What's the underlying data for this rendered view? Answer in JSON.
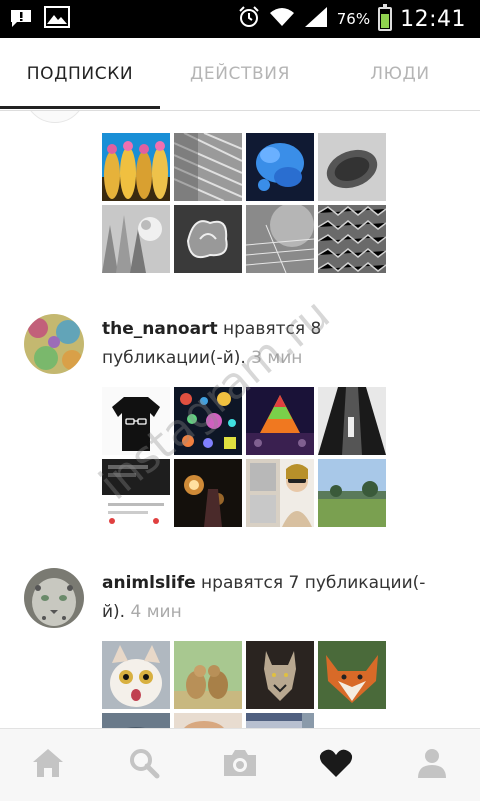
{
  "status_bar": {
    "icons_left": [
      "notification-icon",
      "gallery-icon"
    ],
    "icons_right": [
      "alarm-icon",
      "wifi-icon",
      "signal-icon",
      "battery-icon"
    ],
    "battery_percent": "76%",
    "battery_level": 0.76,
    "time": "12:41",
    "battery_color": "#8fd14f"
  },
  "tabs": [
    {
      "label": "ПОДПИСКИ",
      "active": true
    },
    {
      "label": "ДЕЙСТВИЯ",
      "active": false
    },
    {
      "label": "ЛЮДИ",
      "active": false
    }
  ],
  "stories": [
    {
      "user": "the_nanoart",
      "action": " нравятся 8 публикации(-й).",
      "time": " 3 мин"
    },
    {
      "user": "animlslife",
      "action": " нравятся 7 публикации(-й).",
      "time": " 4 мин"
    }
  ],
  "watermark": "instagram.ru",
  "bottom_nav": [
    "home-icon",
    "search-icon",
    "camera-icon",
    "heart-icon",
    "profile-icon"
  ],
  "colors": {
    "active_tab": "#222222",
    "inactive_tab": "#b5b5b5",
    "time_text": "#aaaaaa",
    "nav_icon": "#c4c4c4",
    "nav_icon_active": "#1a1a1a"
  }
}
